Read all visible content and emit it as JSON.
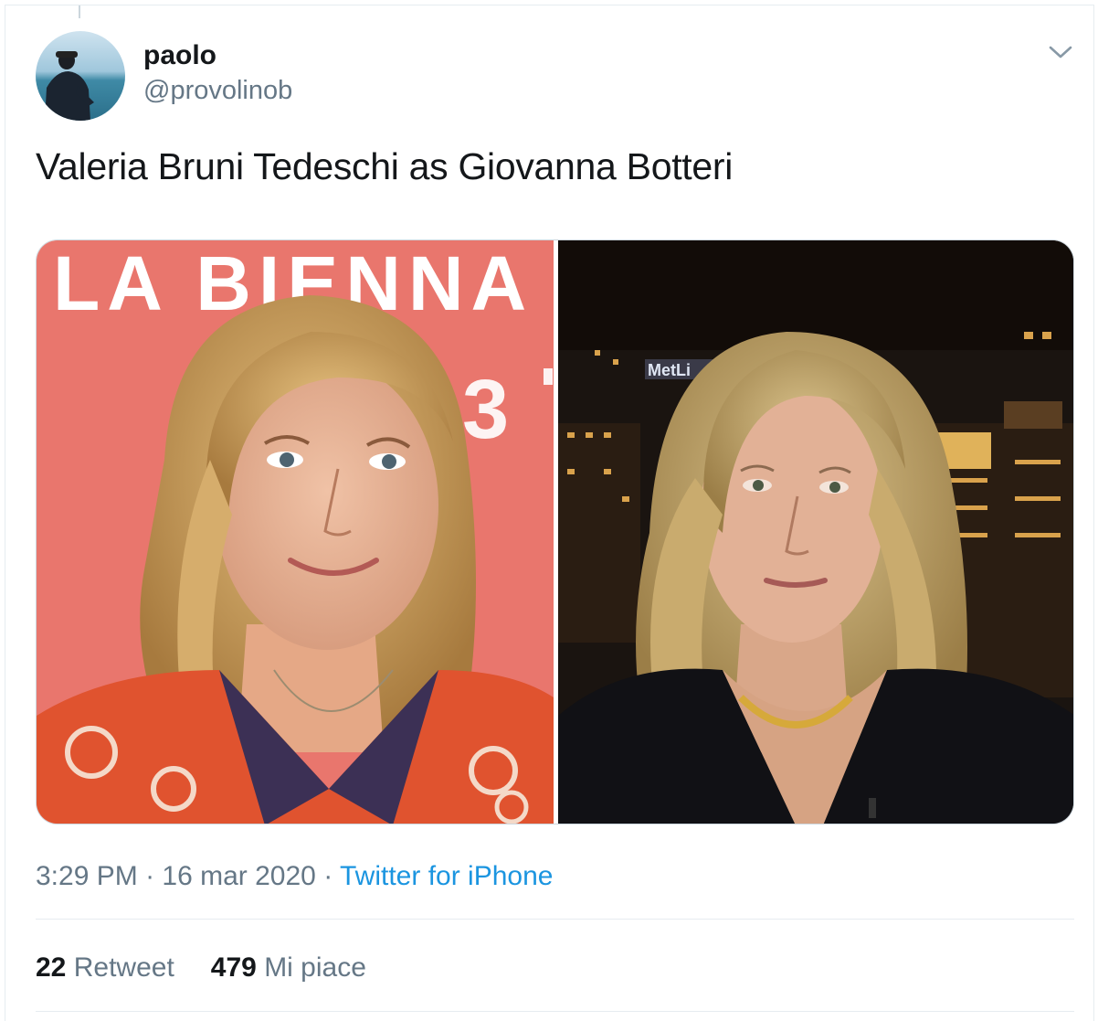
{
  "tweet": {
    "author_name": "paolo",
    "author_handle": "@provolinob",
    "text": "Valeria Bruni Tedeschi as Giovanna Botteri",
    "time": "3:29 PM",
    "separator": "·",
    "date": "16 mar 2020",
    "source": "Twitter for iPhone",
    "retweets_count": "22",
    "retweets_label": "Retweet",
    "likes_count": "479",
    "likes_label": "Mi piace"
  },
  "media": {
    "left_photo": {
      "banner_text": "LA BIENNA",
      "banner_number": "3"
    },
    "right_photo": {
      "sign_text": "MetLi"
    }
  },
  "icons": {
    "menu": "chevron-down-icon"
  },
  "colors": {
    "accent": "#1b95e0",
    "secondary_text": "#657786",
    "border": "#e6ecf0"
  }
}
